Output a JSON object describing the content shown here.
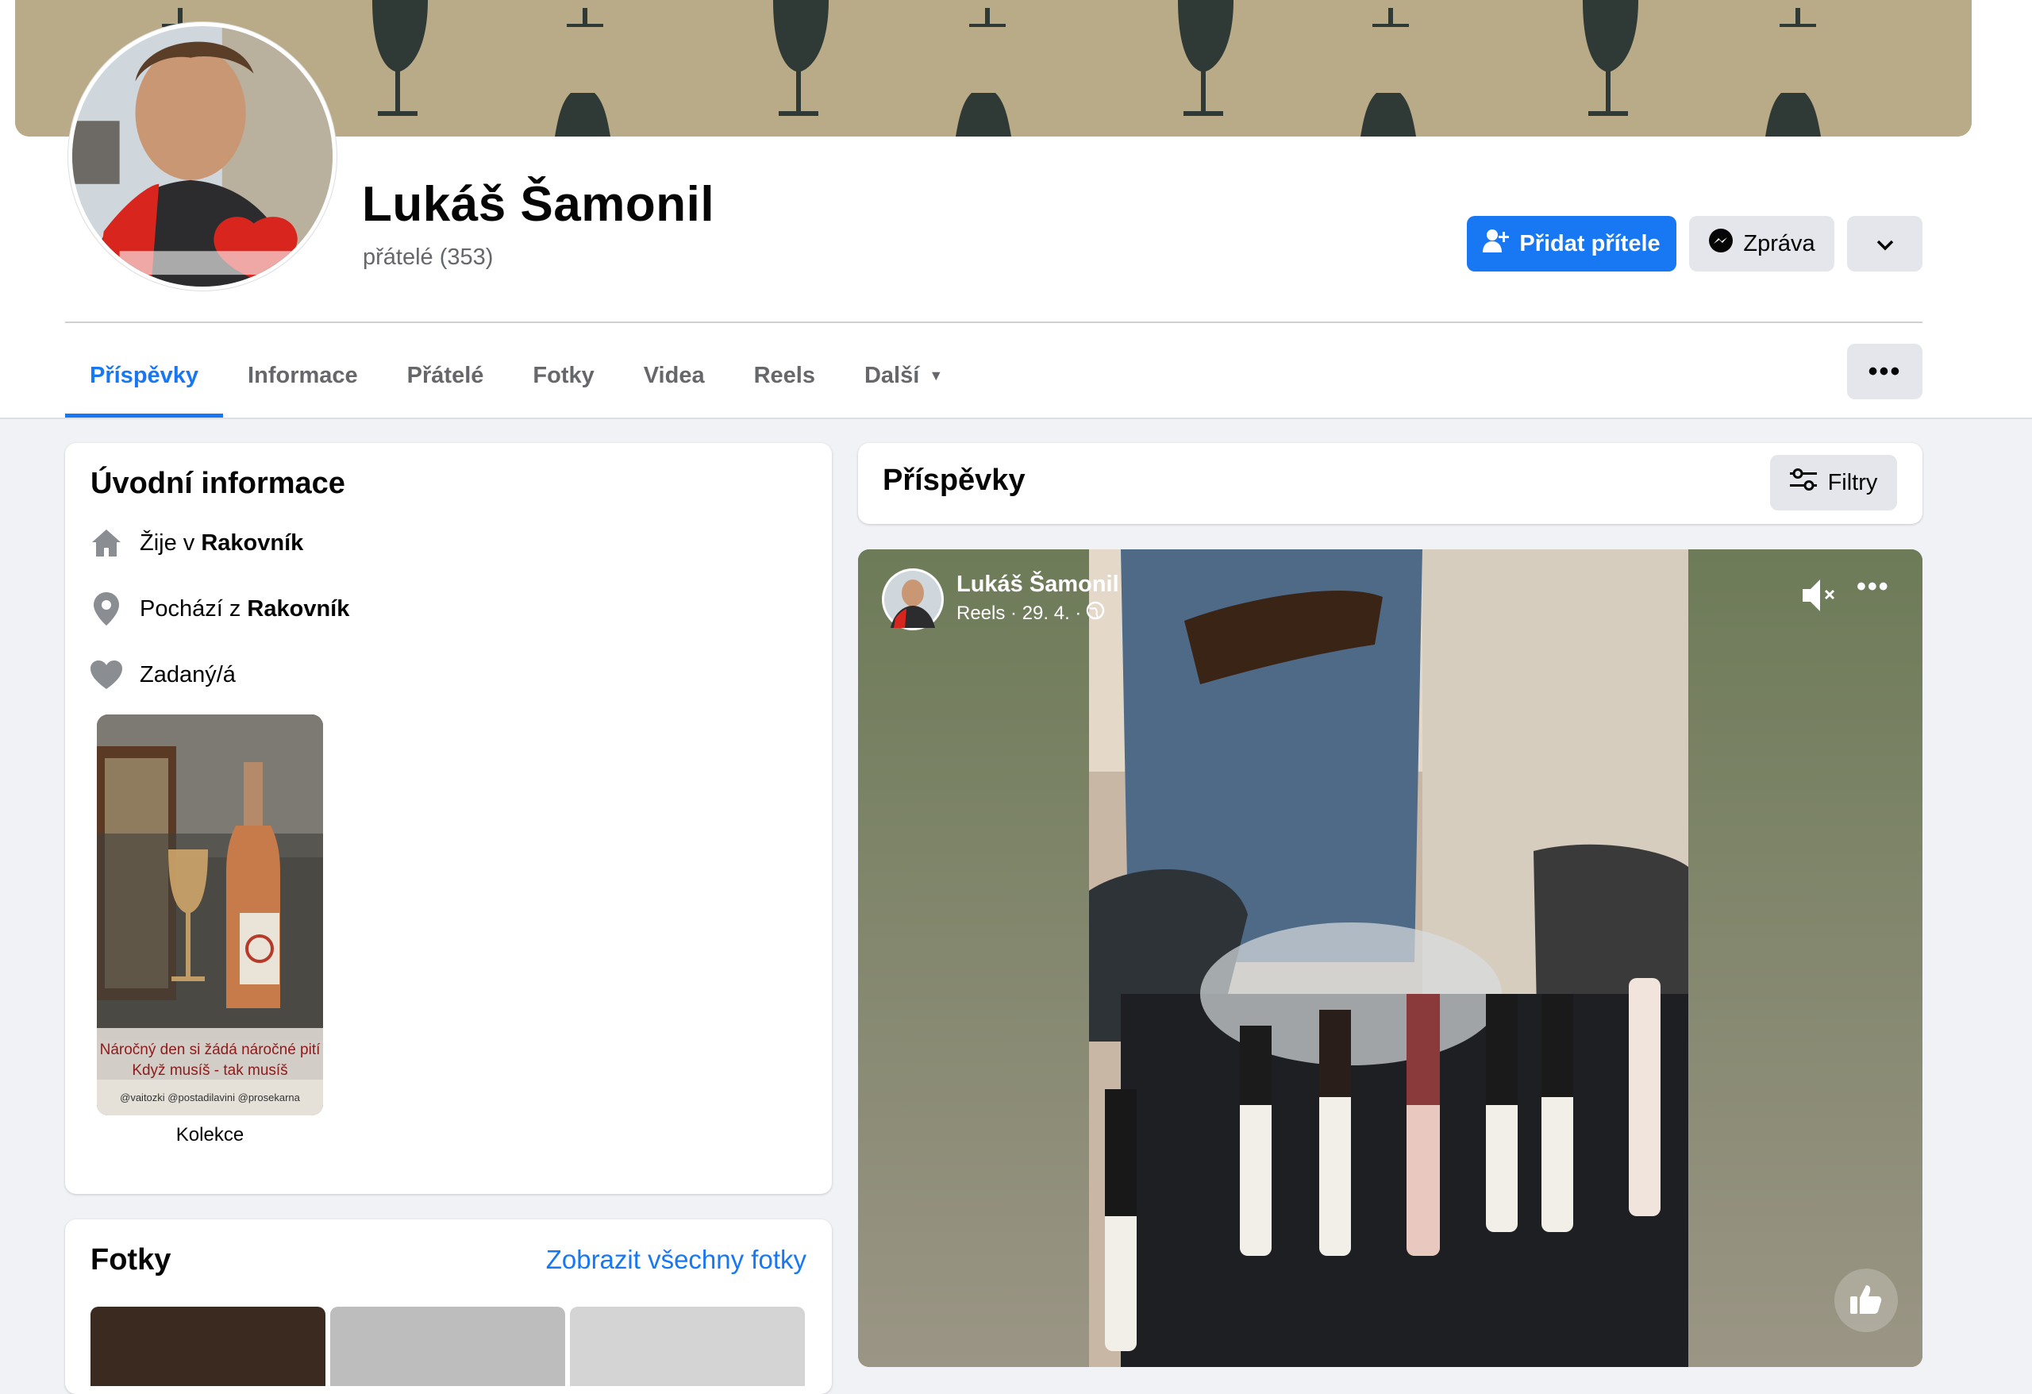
{
  "profile": {
    "name": "Lukáš Šamonil",
    "friends": "přátelé (353)"
  },
  "actions": {
    "add_friend": "Přidat přítele",
    "message": "Zpráva"
  },
  "tabs": [
    {
      "label": "Příspěvky",
      "active": true
    },
    {
      "label": "Informace"
    },
    {
      "label": "Přátelé"
    },
    {
      "label": "Fotky"
    },
    {
      "label": "Videa"
    },
    {
      "label": "Reels"
    },
    {
      "label": "Další"
    }
  ],
  "intro": {
    "title": "Úvodní informace",
    "lives_prefix": "Žije v",
    "lives_city": "Rakovník",
    "from_prefix": "Pochází z",
    "from_city": "Rakovník",
    "relationship": "Zadaný/á",
    "collection_text_1": "Náročný den si žádá náročné pití",
    "collection_text_2": "Když musíš - tak musíš",
    "collection_tags": "@vaitozki   @postadilavini   @prosekarna",
    "collection_label": "Kolekce"
  },
  "photos": {
    "title": "Fotky",
    "link": "Zobrazit všechny fotky"
  },
  "posts": {
    "title": "Příspěvky",
    "filters": "Filtry"
  },
  "reel": {
    "author": "Lukáš Šamonil",
    "meta": "Reels · 29. 4. ·"
  },
  "colors": {
    "accent": "#1877f2",
    "background": "#f0f2f5",
    "secondary_button": "#e4e6eb"
  }
}
